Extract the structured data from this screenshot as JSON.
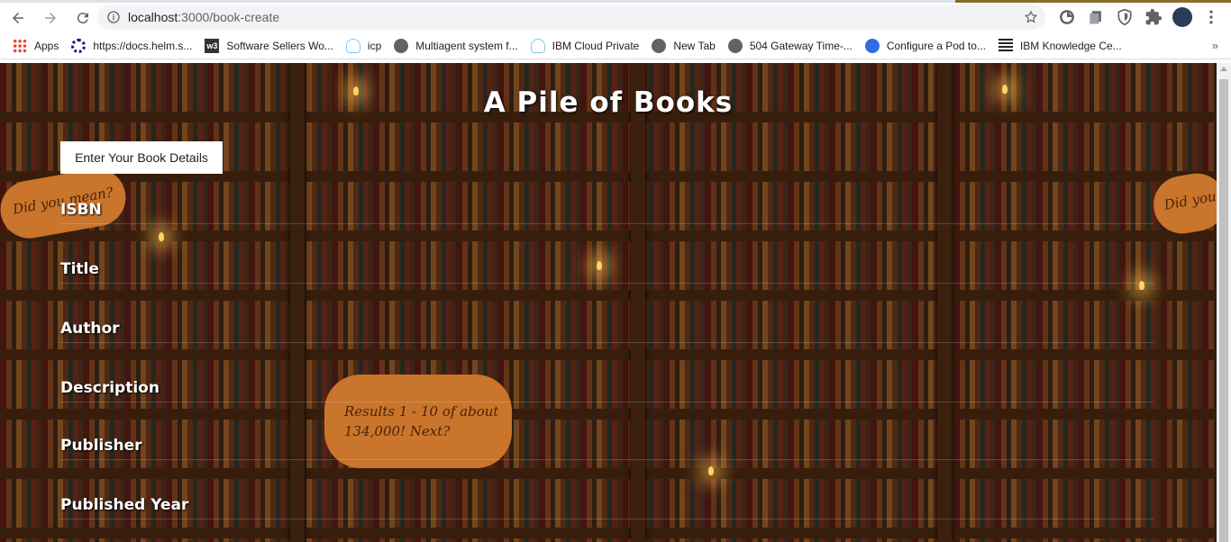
{
  "browser": {
    "url_host": "localhost",
    "url_rest": ":3000/book-create",
    "bookmarks": [
      {
        "label": "Apps",
        "icon": "apps-grid-icon"
      },
      {
        "label": "https://docs.helm.s...",
        "icon": "helm-icon"
      },
      {
        "label": "Software Sellers Wo...",
        "icon": "w3-icon"
      },
      {
        "label": "icp",
        "icon": "cloud-icon"
      },
      {
        "label": "Multiagent system f...",
        "icon": "globe-icon"
      },
      {
        "label": "IBM Cloud Private",
        "icon": "cloud-icon"
      },
      {
        "label": "New Tab",
        "icon": "globe-icon"
      },
      {
        "label": "504 Gateway Time-...",
        "icon": "globe-icon"
      },
      {
        "label": "Configure a Pod to...",
        "icon": "kubernetes-icon"
      },
      {
        "label": "IBM Knowledge Ce...",
        "icon": "ibm-icon"
      }
    ],
    "bookmarks_more": "»"
  },
  "page": {
    "title": "A Pile of Books",
    "details_button": "Enter Your Book Details",
    "fields": [
      {
        "label": "ISBN"
      },
      {
        "label": "Title"
      },
      {
        "label": "Author"
      },
      {
        "label": "Description"
      },
      {
        "label": "Publisher"
      },
      {
        "label": "Published Year"
      }
    ],
    "background_signs": {
      "left": "Did you mean?",
      "center_line1": "Results 1 - 10 of about",
      "center_line2": "134,000! Next?",
      "right": "Did you"
    }
  },
  "colors": {
    "field_label": "#ffffff",
    "button_bg": "#ffffff",
    "sign": "#c9752c",
    "shelf_wood": "#4a2a12"
  }
}
